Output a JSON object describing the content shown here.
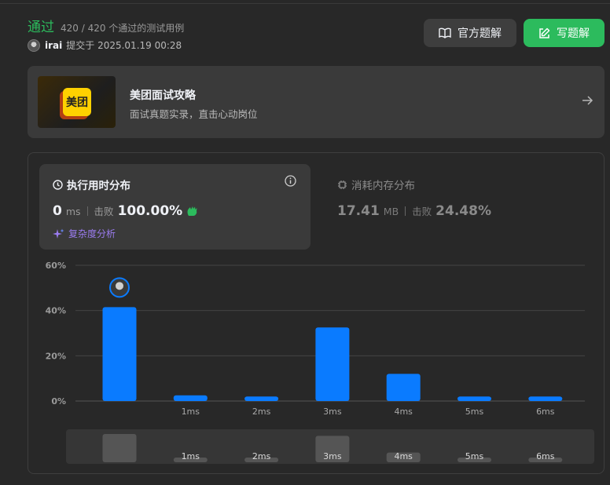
{
  "header": {
    "status": "通过",
    "testcases": "420 / 420 个通过的测试用例",
    "user": "irai",
    "submitted_at": "提交于 2025.01.19 00:28",
    "official_solution_label": "官方题解",
    "write_solution_label": "写题解"
  },
  "banner": {
    "logo_text": "美团",
    "title": "美团面试攻略",
    "subtitle": "面试真题实录，直击心动岗位"
  },
  "runtime": {
    "title": "执行用时分布",
    "value": "0",
    "unit": "ms",
    "beat_label": "击败",
    "beat_value": "100.00%",
    "complexity_link": "复杂度分析"
  },
  "memory": {
    "title": "消耗内存分布",
    "value": "17.41",
    "unit": "MB",
    "beat_label": "击败",
    "beat_value": "24.48%"
  },
  "colors": {
    "accent_green": "#2cbb5d",
    "bar_blue": "#0a7bff",
    "complexity_purple": "#9b7cf0"
  },
  "chart_data": {
    "type": "bar",
    "categories": [
      "0ms",
      "1ms",
      "2ms",
      "3ms",
      "4ms",
      "5ms",
      "6ms"
    ],
    "tick_labels": [
      "",
      "1ms",
      "2ms",
      "3ms",
      "4ms",
      "5ms",
      "6ms"
    ],
    "values": [
      41.5,
      2.5,
      2,
      32.5,
      12,
      2,
      2
    ],
    "ylim": [
      0,
      60
    ],
    "yticks": [
      0,
      20,
      40,
      60
    ],
    "ytick_labels": [
      "0%",
      "20%",
      "40%",
      "60%"
    ],
    "grid": true,
    "highlight_index": 0,
    "xlabel": "",
    "ylabel": ""
  }
}
